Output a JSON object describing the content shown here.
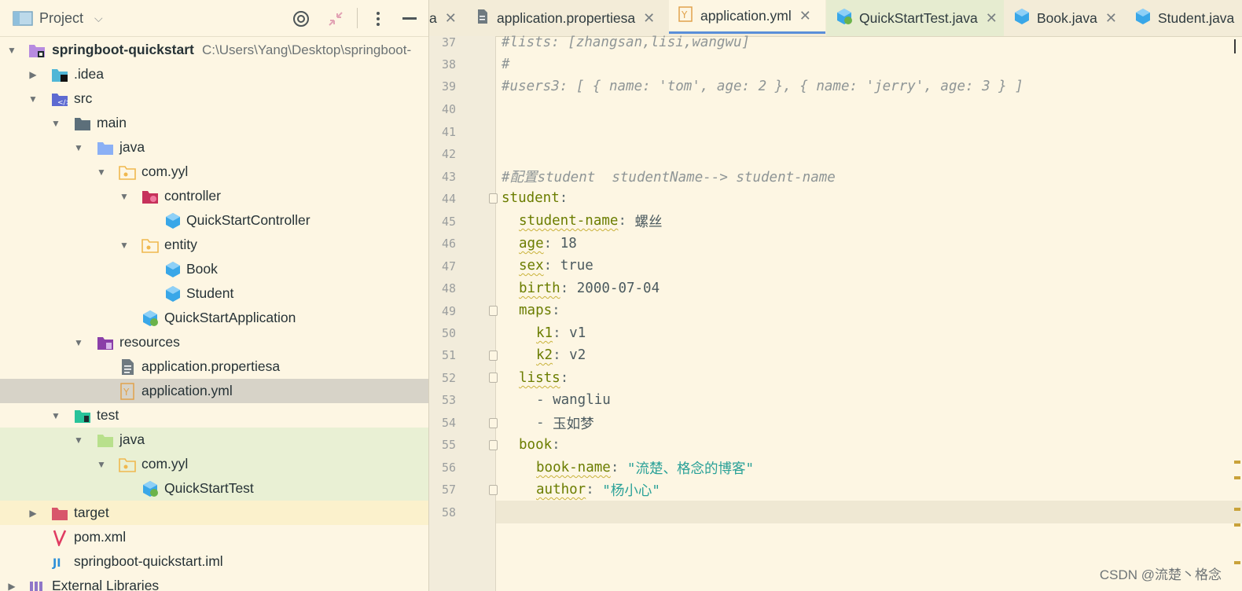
{
  "project_panel": {
    "title": "Project",
    "tree": [
      {
        "label": "springboot-quickstart",
        "path": "C:\\Users\\Yang\\Desktop\\springboot-",
        "icon": "module-icon",
        "arrow": "down"
      },
      {
        "label": ".idea",
        "icon": "idea-folder-icon",
        "arrow": "right"
      },
      {
        "label": "src",
        "icon": "src-folder-icon",
        "arrow": "down"
      },
      {
        "label": "main",
        "icon": "folder-icon",
        "arrow": "down"
      },
      {
        "label": "java",
        "icon": "source-folder-icon",
        "arrow": "down"
      },
      {
        "label": "com.yyl",
        "icon": "package-icon",
        "arrow": "down"
      },
      {
        "label": "controller",
        "icon": "controller-package-icon",
        "arrow": "down"
      },
      {
        "label": "QuickStartController",
        "icon": "class-icon",
        "arrow": "none"
      },
      {
        "label": "entity",
        "icon": "package-icon",
        "arrow": "down"
      },
      {
        "label": "Book",
        "icon": "class-icon",
        "arrow": "none"
      },
      {
        "label": "Student",
        "icon": "class-icon",
        "arrow": "none"
      },
      {
        "label": "QuickStartApplication",
        "icon": "spring-boot-class-icon",
        "arrow": "none"
      },
      {
        "label": "resources",
        "icon": "resources-folder-icon",
        "arrow": "down"
      },
      {
        "label": "application.propertiesa",
        "icon": "text-file-icon",
        "arrow": "none"
      },
      {
        "label": "application.yml",
        "icon": "yaml-file-icon",
        "arrow": "none"
      },
      {
        "label": "test",
        "icon": "test-folder-icon",
        "arrow": "down"
      },
      {
        "label": "java",
        "icon": "test-source-folder-icon",
        "arrow": "down"
      },
      {
        "label": "com.yyl",
        "icon": "package-icon",
        "arrow": "down"
      },
      {
        "label": "QuickStartTest",
        "icon": "spring-boot-class-icon",
        "arrow": "none"
      },
      {
        "label": "target",
        "icon": "target-folder-icon",
        "arrow": "right"
      },
      {
        "label": "pom.xml",
        "icon": "maven-icon",
        "arrow": "none"
      },
      {
        "label": "springboot-quickstart.iml",
        "icon": "iml-file-icon",
        "arrow": "none"
      },
      {
        "label": "External Libraries",
        "icon": "libraries-icon",
        "arrow": "right"
      }
    ]
  },
  "tabs": [
    {
      "label": "a",
      "icon": "none"
    },
    {
      "label": "application.propertiesa",
      "icon": "text-file-icon"
    },
    {
      "label": "application.yml",
      "icon": "yaml-file-icon",
      "active": true
    },
    {
      "label": "QuickStartTest.java",
      "icon": "spring-boot-class-icon"
    },
    {
      "label": "Book.java",
      "icon": "class-icon"
    },
    {
      "label": "Student.java",
      "icon": "class-icon"
    }
  ],
  "editor": {
    "line_numbers": [
      "37",
      "38",
      "39",
      "40",
      "41",
      "42",
      "43",
      "44",
      "45",
      "46",
      "47",
      "48",
      "49",
      "50",
      "51",
      "52",
      "53",
      "54",
      "55",
      "56",
      "57",
      "58"
    ],
    "lines": {
      "l37": "#lists: [zhangsan,lisi,wangwu]",
      "l38": "#",
      "l39": "#users3: [ { name: 'tom', age: 2 }, { name: 'jerry', age: 3 } ]",
      "l43": "#配置student  studentName--> student-name",
      "l44_key": "student",
      "l45_key": "student-name",
      "l45_val": "螺丝",
      "l46_key": "age",
      "l46_val": "18",
      "l47_key": "sex",
      "l47_val": "true",
      "l48_key": "birth",
      "l48_val": "2000-07-04",
      "l49_key": "maps",
      "l50_key": "k1",
      "l50_val": "v1",
      "l51_key": "k2",
      "l51_val": "v2",
      "l52_key": "lists",
      "l53_val": "wangliu",
      "l54_val": "玉如梦",
      "l55_key": "book",
      "l56_key": "book-name",
      "l56_val": "\"流楚、格念的博客\"",
      "l57_key": "author",
      "l57_val": "\"杨小心\""
    }
  },
  "watermark": "CSDN @流楚丶格念",
  "colors": {
    "background": "#fdf6e3",
    "key": "#6b7d00",
    "string": "#2aa198",
    "comment": "#8e9596",
    "active_tab_underline": "#5a8fd9"
  }
}
